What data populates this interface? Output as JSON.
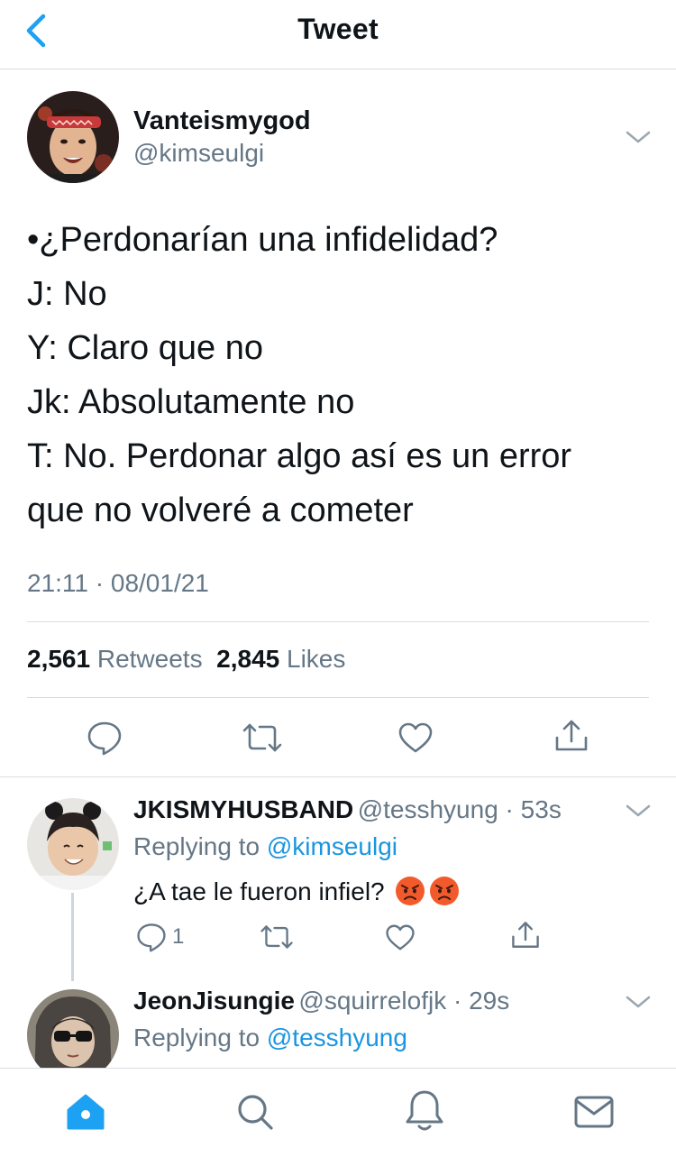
{
  "header": {
    "title": "Tweet",
    "back_icon": "chevron-left-icon"
  },
  "tweet": {
    "author_name": "Vanteismygod",
    "author_handle": "@kimseulgi",
    "lines": [
      "•¿Perdonarían una infidelidad?",
      "J: No",
      "Y: Claro que no",
      "Jk: Absolutamente no",
      "T: No. Perdonar algo así es un error",
      "que no volveré a cometer"
    ],
    "timestamp": "21:11 · 08/01/21",
    "retweets_count": "2,561",
    "retweets_label": "Retweets",
    "likes_count": "2,845",
    "likes_label": "Likes",
    "actions": [
      "comment-icon",
      "retweet-icon",
      "heart-icon",
      "share-icon"
    ]
  },
  "replies": [
    {
      "name": "JKISMYHUSBAND",
      "handle": "@tesshyung",
      "time": "53s",
      "replying_prefix": "Replying to",
      "replying_to": "@kimseulgi",
      "text": "¿A tae le fueron infiel?",
      "emojis": [
        "angry-face-emoji",
        "angry-face-emoji"
      ],
      "reply_count": "1"
    },
    {
      "name": "JeonJisungie",
      "handle": "@squirrelofjk",
      "time": "29s",
      "replying_prefix": "Replying to",
      "replying_to": "@tesshyung"
    }
  ],
  "tabbar": {
    "items": [
      "home-icon",
      "search-icon",
      "notifications-icon",
      "messages-icon"
    ],
    "active": "home-icon"
  },
  "colors": {
    "accent": "#1da1f2",
    "link": "#1b95e0",
    "secondary_text": "#657786",
    "divider": "#d9dde0",
    "icon": "#657786"
  }
}
